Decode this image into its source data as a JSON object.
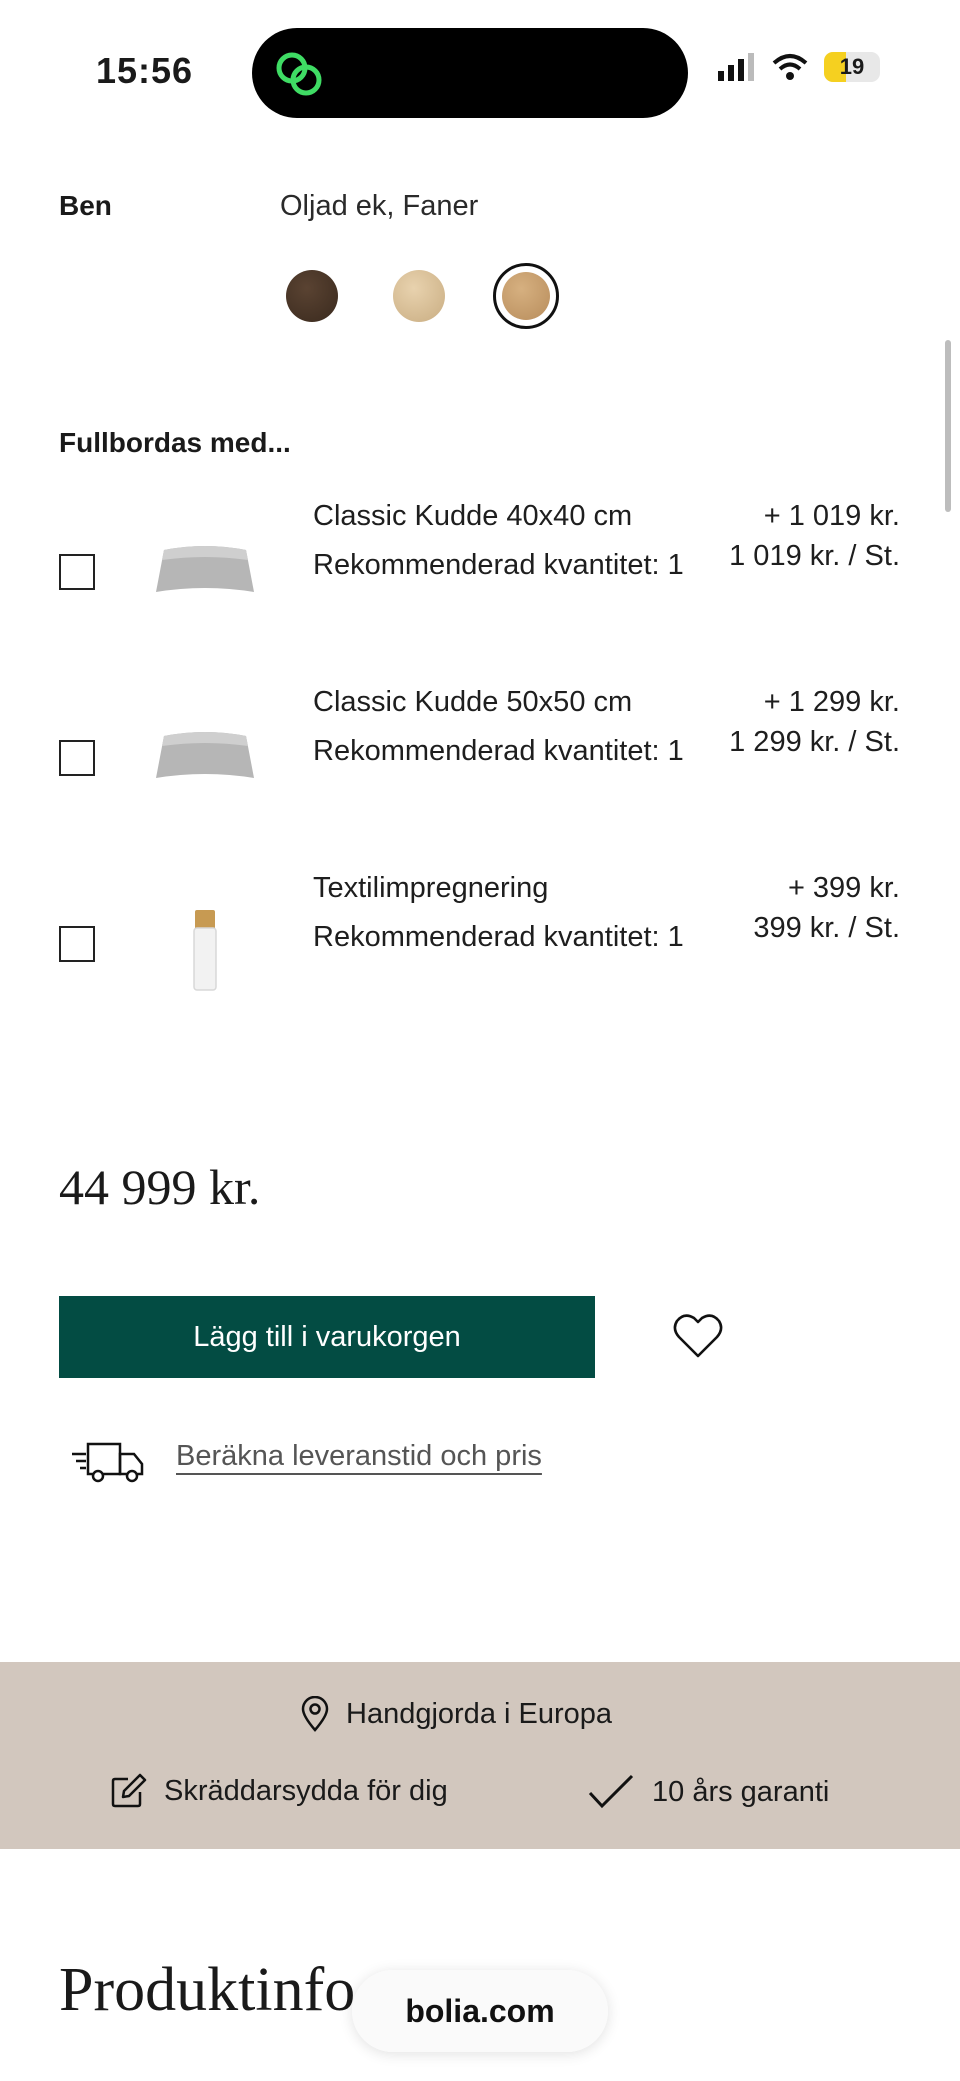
{
  "status_bar": {
    "time": "15:56",
    "battery": "19"
  },
  "legs": {
    "label": "Ben",
    "value": "Oljad ek, Faner",
    "swatches": [
      {
        "name": "dark-oak",
        "color": "#4a3627",
        "selected": false
      },
      {
        "name": "light-oak",
        "color": "#d9c097",
        "selected": false
      },
      {
        "name": "oiled-oak",
        "color": "#c9a06e",
        "selected": true
      }
    ]
  },
  "addons": {
    "title": "Fullbordas med...",
    "items": [
      {
        "name": "Classic Kudde 40x40 cm",
        "recommended": "Rekommenderad kvantitet: 1",
        "price": "+ 1 019 kr.",
        "unit_price": "1 019 kr. / St.",
        "checked": false,
        "icon": "pillow-image"
      },
      {
        "name": "Classic Kudde 50x50 cm",
        "recommended": "Rekommenderad kvantitet: 1",
        "price": "+ 1 299 kr.",
        "unit_price": "1 299 kr. / St.",
        "checked": false,
        "icon": "pillow-image"
      },
      {
        "name": "Textilimpregnering",
        "recommended": "Rekommenderad kvantitet: 1",
        "price": "+ 399 kr.",
        "unit_price": "399 kr. / St.",
        "checked": false,
        "icon": "spray-bottle-image"
      }
    ]
  },
  "price": "44 999 kr.",
  "cart": {
    "label": "Lägg till i varukorgen",
    "color": "#034c43"
  },
  "delivery": {
    "link": "Beräkna leveranstid och pris"
  },
  "benefits": {
    "band_color": "#d2c7be",
    "items": [
      {
        "icon": "location-pin-icon",
        "label": "Handgjorda i Europa"
      },
      {
        "icon": "edit-icon",
        "label": "Skräddarsydda för dig"
      },
      {
        "icon": "checkmark-icon",
        "label": "10 års garanti"
      }
    ]
  },
  "product_info": {
    "heading": "Produktinfo"
  },
  "browser": {
    "url": "bolia.com"
  }
}
